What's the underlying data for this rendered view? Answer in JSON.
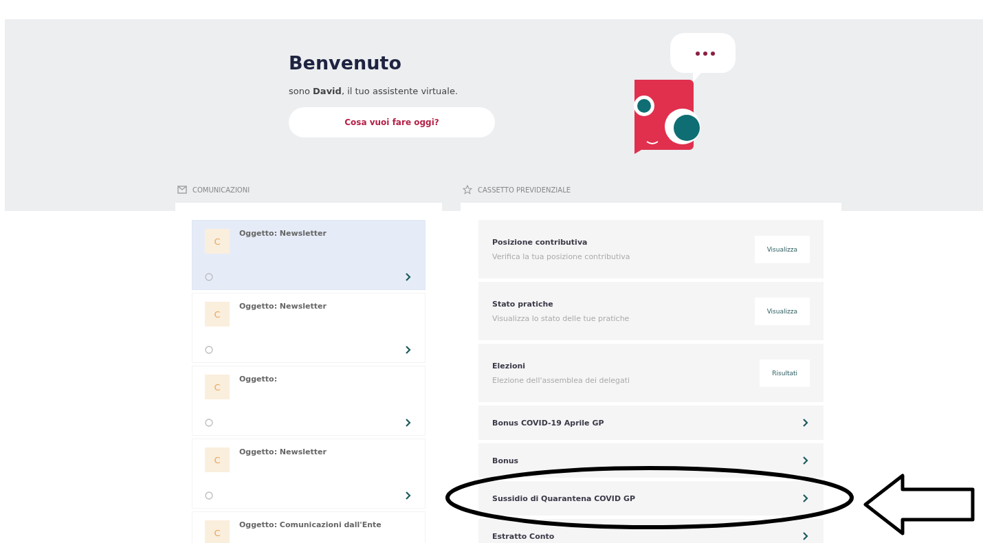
{
  "hero": {
    "title": "Benvenuto",
    "greeting": "sono **David**, il tuo assistente virtuale.",
    "prompt_button": "Cosa vuoi fare oggi?"
  },
  "communications": {
    "heading": "COMUNICAZIONI",
    "items": [
      {
        "avatar": "C",
        "subject": "Oggetto: Newsletter",
        "selected": true
      },
      {
        "avatar": "C",
        "subject": "Oggetto: Newsletter",
        "selected": false
      },
      {
        "avatar": "C",
        "subject": "Oggetto:",
        "selected": false
      },
      {
        "avatar": "C",
        "subject": "Oggetto: Newsletter",
        "selected": false
      },
      {
        "avatar": "C",
        "subject": "Oggetto: Comunicazioni dall'Ente",
        "selected": false
      }
    ]
  },
  "cassetto": {
    "heading": "CASSETTO PREVIDENZIALE",
    "items": [
      {
        "kind": "action",
        "title": "Posizione contributiva",
        "subtitle": "Verifica la tua posizione contributiva",
        "button": "Visualizza"
      },
      {
        "kind": "action",
        "title": "Stato pratiche",
        "subtitle": "Visualizza lo stato delle tue pratiche",
        "button": "Visualizza"
      },
      {
        "kind": "action",
        "title": "Elezioni",
        "subtitle": "Elezione dell'assemblea dei delegati",
        "button": "Risultati"
      },
      {
        "kind": "link",
        "title": "Bonus COVID-19 Aprile GP"
      },
      {
        "kind": "link",
        "title": "Bonus"
      },
      {
        "kind": "link",
        "title": "Sussidio di Quarantena COVID GP"
      },
      {
        "kind": "link",
        "title": "Estratto Conto"
      }
    ]
  }
}
